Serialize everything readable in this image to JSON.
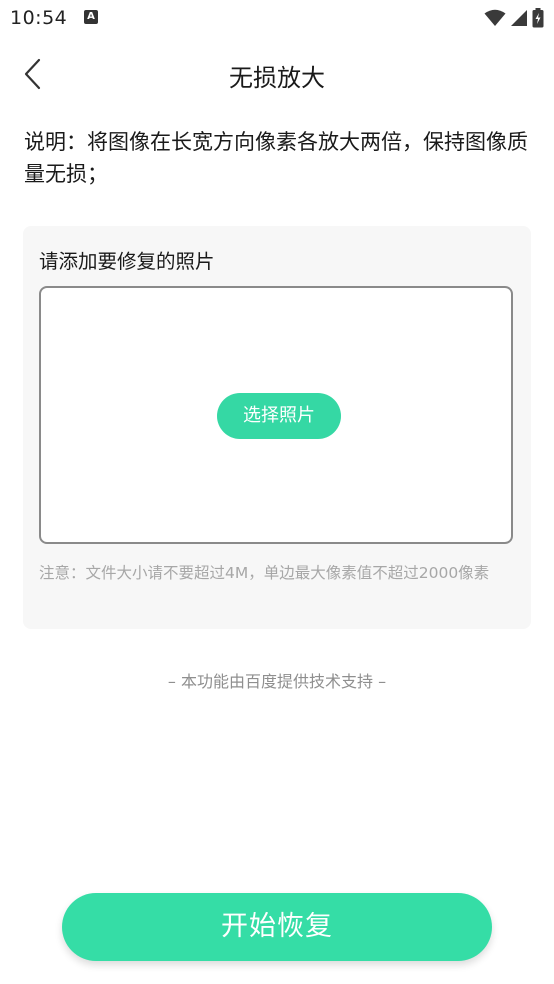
{
  "status_bar": {
    "time": "10:54",
    "notification_icon": "A",
    "icons": [
      "wifi-icon",
      "signal-icon",
      "battery-charging-icon"
    ]
  },
  "header": {
    "title": "无损放大",
    "back_icon": "chevron-left-icon"
  },
  "description": "说明：将图像在长宽方向像素各放大两倍，保持图像质量无损；",
  "upload_card": {
    "title": "请添加要修复的照片",
    "select_button_label": "选择照片",
    "note": "注意：文件大小请不要超过4M，单边最大像素值不超过2000像素"
  },
  "powered_by": "– 本功能由百度提供技术支持 –",
  "start_button_label": "开始恢复",
  "colors": {
    "accent": "#35d8a4",
    "note_text": "#a7a7a7",
    "card_bg": "#f7f7f7"
  }
}
